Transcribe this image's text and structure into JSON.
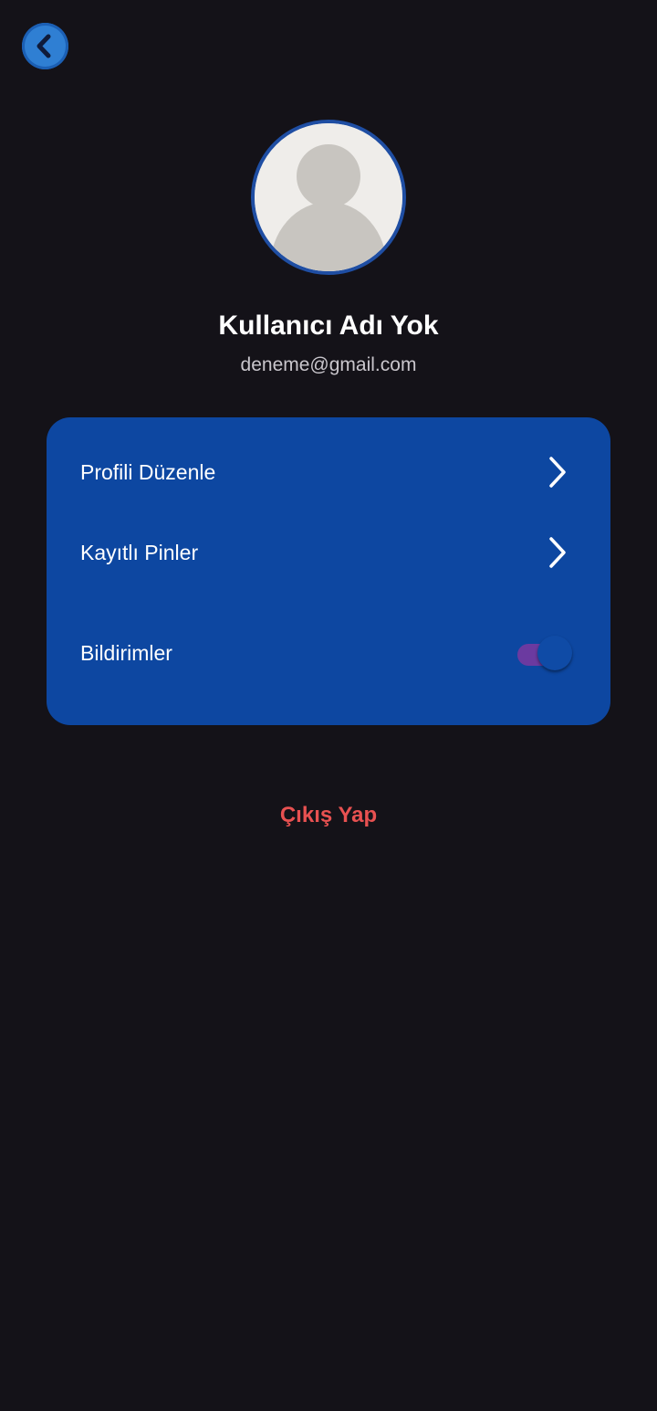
{
  "header": {
    "back_icon": "chevron-left-icon"
  },
  "profile": {
    "avatar_icon": "default-user-avatar",
    "name": "Kullanıcı Adı Yok",
    "email": "deneme@gmail.com"
  },
  "settings": {
    "items": [
      {
        "label": "Profili Düzenle",
        "icon": "chevron-right-icon"
      },
      {
        "label": "Kayıtlı Pinler",
        "icon": "chevron-right-icon"
      },
      {
        "label": "Bildirimler",
        "control": "toggle",
        "enabled": true
      }
    ]
  },
  "logout": {
    "label": "Çıkış Yap"
  },
  "colors": {
    "background": "#141218",
    "card": "#0d47a1",
    "accent": "#2f7fd3",
    "logout": "#e85151",
    "toggle_track": "#6b3aa0"
  }
}
